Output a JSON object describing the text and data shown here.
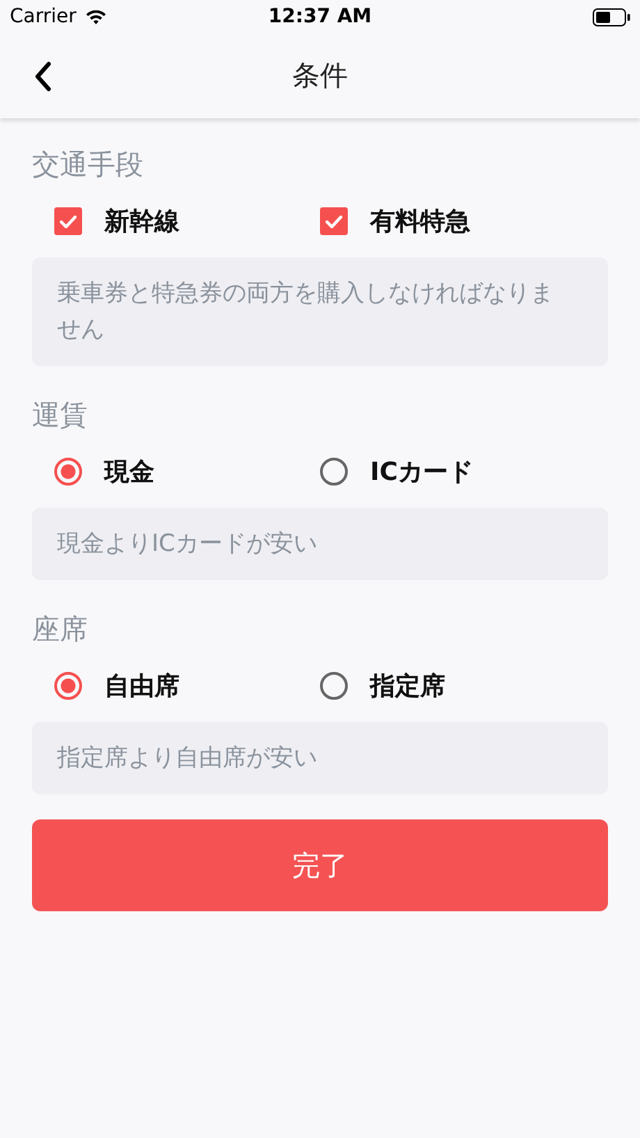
{
  "status_bar": {
    "carrier": "Carrier",
    "time": "12:37 AM"
  },
  "nav": {
    "title": "条件"
  },
  "sections": [
    {
      "title": "交通手段",
      "kind": "checkbox",
      "options": [
        {
          "label": "新幹線",
          "checked": true
        },
        {
          "label": "有料特急",
          "checked": true
        }
      ],
      "note": "乗車券と特急券の両方を購入しなければなりません"
    },
    {
      "title": "運賃",
      "kind": "radio",
      "options": [
        {
          "label": "現金",
          "selected": true
        },
        {
          "label": "ICカード",
          "selected": false
        }
      ],
      "note": "現金よりICカードが安い"
    },
    {
      "title": "座席",
      "kind": "radio",
      "options": [
        {
          "label": "自由席",
          "selected": true
        },
        {
          "label": "指定席",
          "selected": false
        }
      ],
      "note": "指定席より自由席が安い"
    }
  ],
  "button": "完了"
}
